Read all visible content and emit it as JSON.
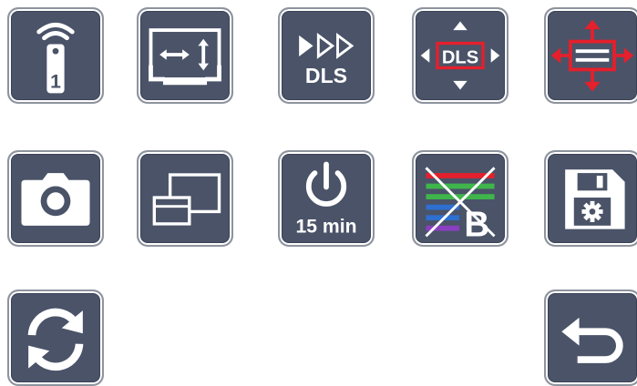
{
  "tiles": {
    "remote": {
      "icon": "remote-control-icon",
      "number": "1"
    },
    "aspect": {
      "icon": "aspect-ratio-icon"
    },
    "dls_forward": {
      "icon": "fast-forward-icon",
      "label": "DLS"
    },
    "dls_adjust": {
      "icon": "dls-adjust-icon",
      "label": "DLS"
    },
    "position_adjust": {
      "icon": "position-adjust-icon"
    },
    "camera": {
      "icon": "camera-icon"
    },
    "pip": {
      "icon": "picture-in-picture-icon"
    },
    "sleep_timer": {
      "icon": "power-timer-icon",
      "label": "15 min"
    },
    "color_bars_off": {
      "icon": "color-bars-off-icon",
      "letter": "B"
    },
    "save_settings": {
      "icon": "save-settings-icon"
    },
    "refresh": {
      "icon": "refresh-icon"
    },
    "back": {
      "icon": "back-arrow-icon"
    }
  },
  "colors": {
    "tile_bg": "#4a5368",
    "icon": "#ffffff",
    "accent_red": "#e4202c"
  }
}
